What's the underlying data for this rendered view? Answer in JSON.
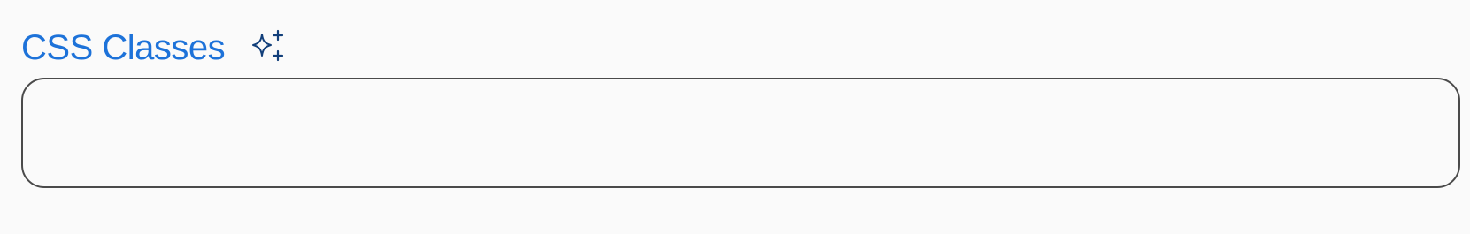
{
  "field": {
    "label": "CSS Classes",
    "value": "",
    "ai_icon": "sparkle-icon"
  },
  "colors": {
    "label": "#1d72d9",
    "border": "#4a4a4a",
    "background": "#fafafa"
  }
}
